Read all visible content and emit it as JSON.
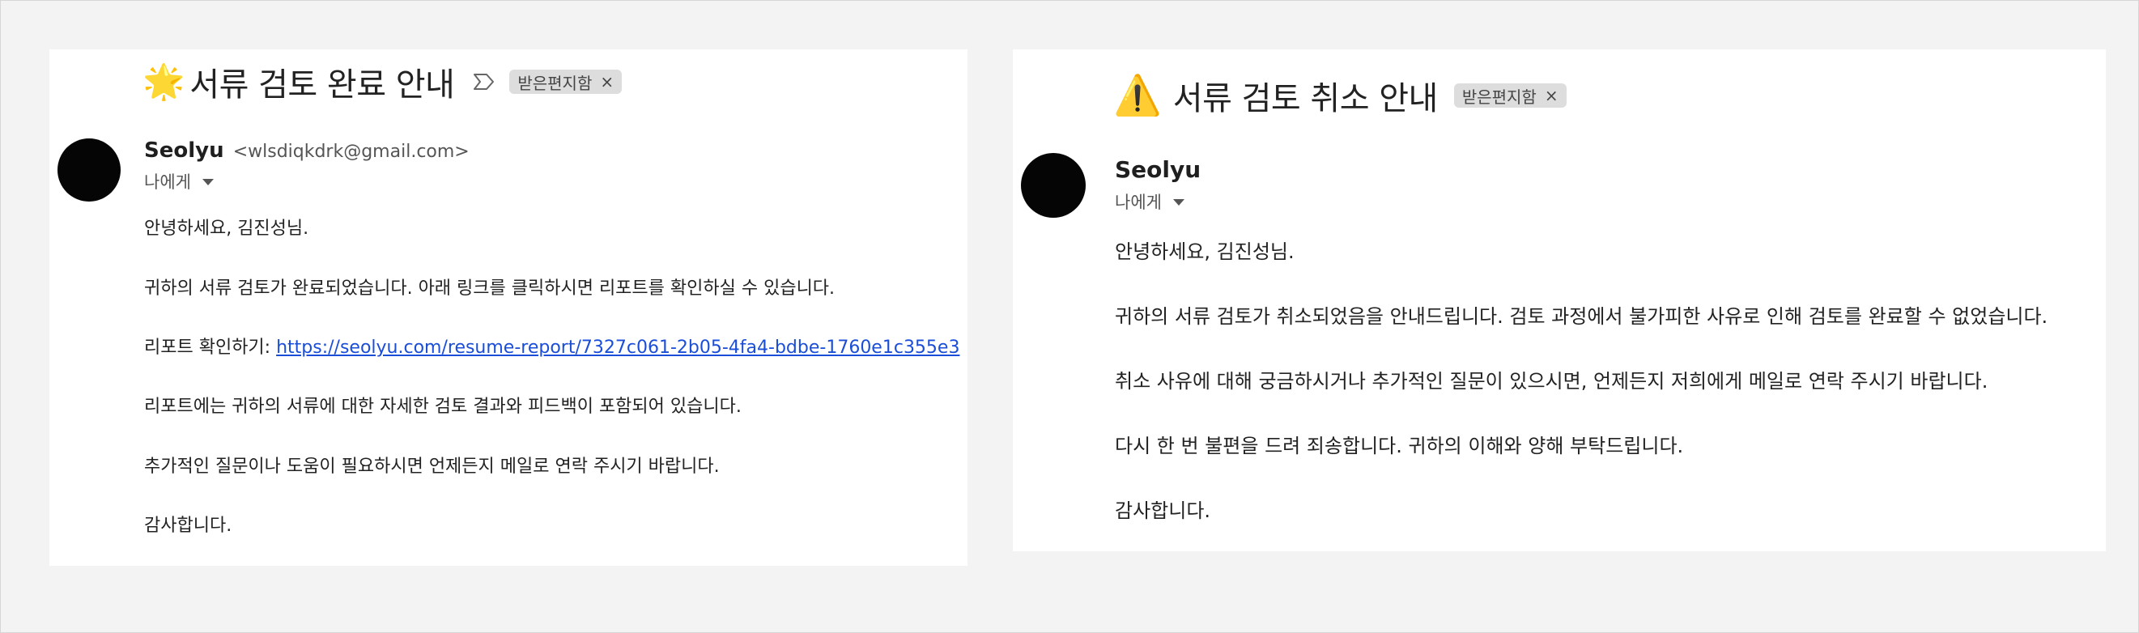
{
  "emails": [
    {
      "subject": "서류 검토 완료 안내",
      "subject_emoji": "🌟",
      "label": "받은편지함",
      "sender_name": "Seolyu",
      "sender_email": "<wlsdiqkdrk@gmail.com>",
      "recipient": "나에게",
      "greeting": "안녕하세요, 김진성님.",
      "para1": "귀하의 서류 검토가 완료되었습니다. 아래 링크를 클릭하시면 리포트를 확인하실 수 있습니다.",
      "link_prefix": "리포트 확인하기: ",
      "link_url": "https://seolyu.com/resume-report/7327c061-2b05-4fa4-bdbe-1760e1c355e3",
      "para2": "리포트에는 귀하의 서류에 대한 자세한 검토 결과와 피드백이 포함되어 있습니다.",
      "para3": "추가적인 질문이나 도움이 필요하시면 언제든지 메일로 연락 주시기 바랍니다.",
      "closing": "감사합니다."
    },
    {
      "subject": "서류 검토 취소 안내",
      "subject_emoji": "⚠️",
      "label": "받은편지함",
      "sender_name": "Seolyu",
      "recipient": "나에게",
      "greeting": "안녕하세요, 김진성님.",
      "para1": "귀하의 서류 검토가 취소되었음을 안내드립니다. 검토 과정에서 불가피한 사유로 인해 검토를 완료할 수 없었습니다.",
      "para2": "취소 사유에 대해 궁금하시거나 추가적인 질문이 있으시면, 언제든지 저희에게 메일로 연락 주시기 바랍니다.",
      "para3": "다시 한 번 불편을 드려 죄송합니다. 귀하의 이해와 양해 부탁드립니다.",
      "closing": "감사합니다."
    }
  ],
  "icons": {
    "label_close": "×",
    "important_marker": "important-marker-icon",
    "recipient_dropdown": "caret-down-icon"
  },
  "colors": {
    "link": "#1a4ed8",
    "chip_background": "#dddddd",
    "avatar": "#050505",
    "page_background": "#f3f3f3"
  }
}
